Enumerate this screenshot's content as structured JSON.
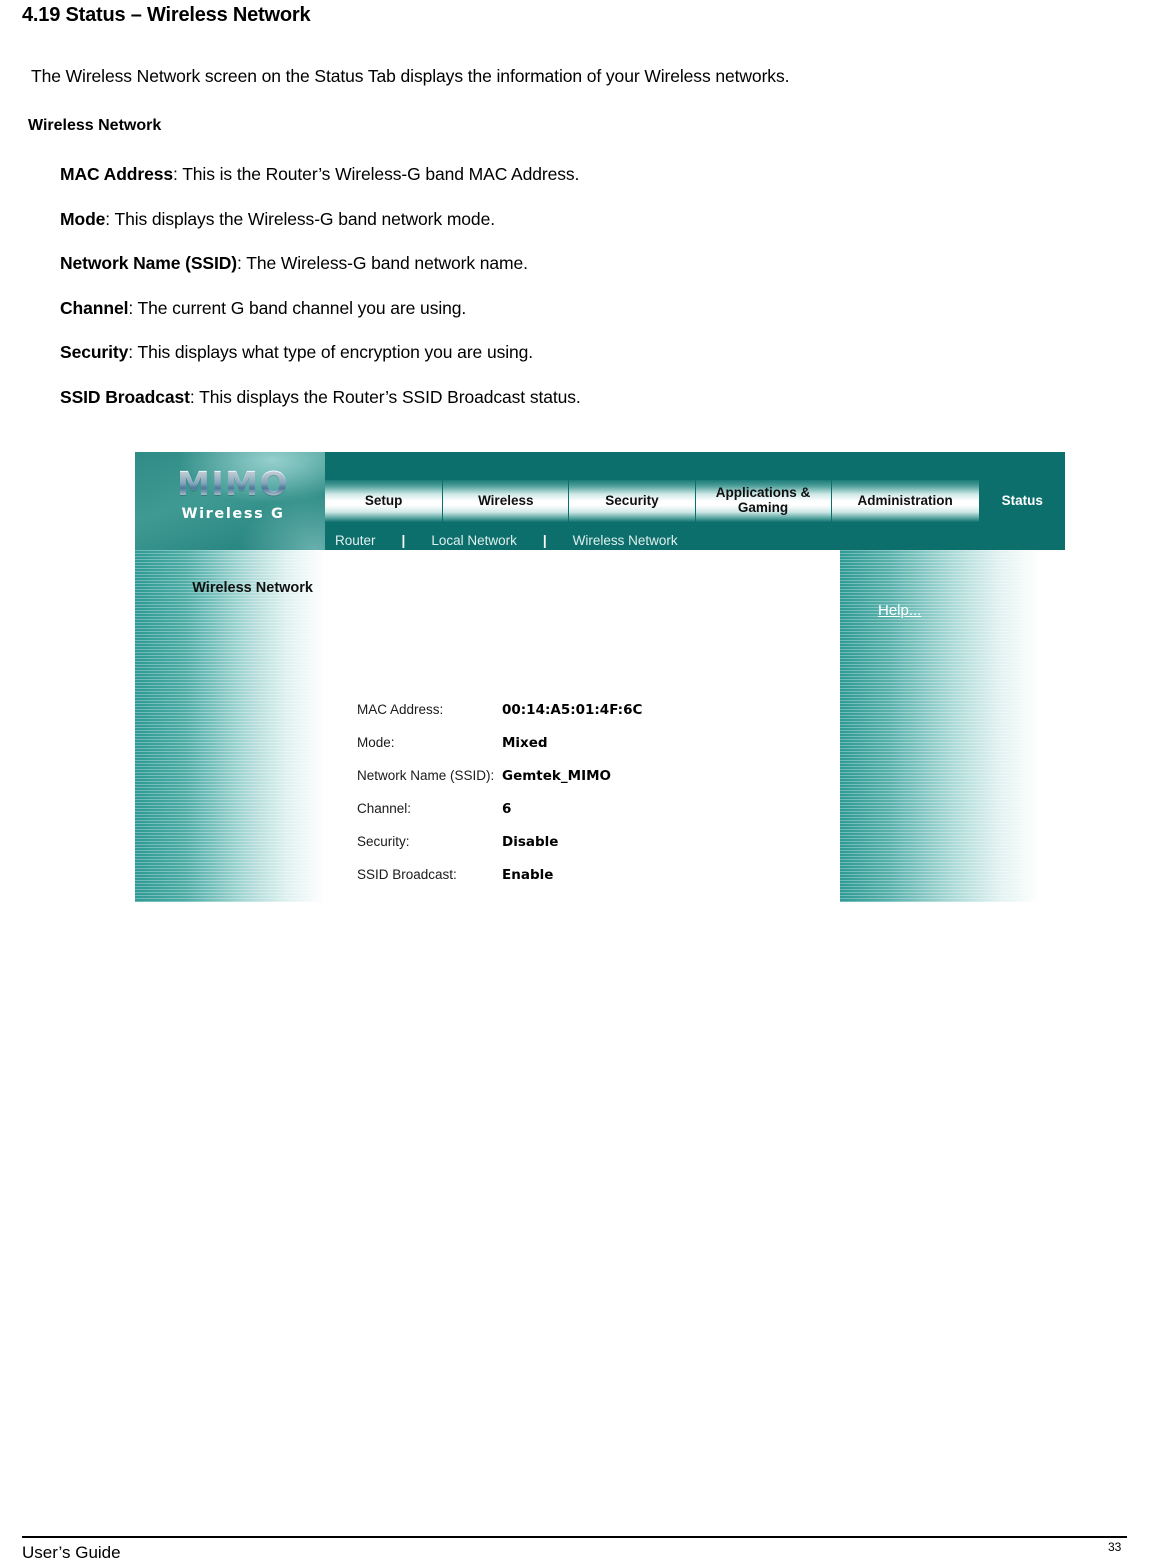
{
  "document": {
    "title": "4.19 Status – Wireless Network",
    "intro": "The Wireless Network screen on the Status Tab displays the information of your Wireless networks.",
    "subheading": "Wireless Network",
    "definitions": [
      {
        "term": "MAC Address",
        "text": ": This is the Router’s Wireless-G band MAC Address."
      },
      {
        "term": "Mode",
        "text": ": This displays the Wireless-G band network mode."
      },
      {
        "term": "Network Name (SSID)",
        "text": ": The Wireless-G band network name."
      },
      {
        "term": "Channel",
        "text": ": The current G band channel you are using."
      },
      {
        "term": "Security",
        "text": ": This displays what type of encryption you are using."
      },
      {
        "term": "SSID Broadcast",
        "text": ": This displays the Router’s SSID Broadcast status."
      }
    ]
  },
  "screenshot": {
    "logo": {
      "brand": "MIMO",
      "tagline": "Wireless G"
    },
    "tabs": [
      {
        "label": "Setup",
        "active": false
      },
      {
        "label": "Wireless",
        "active": false
      },
      {
        "label": "Security",
        "active": false
      },
      {
        "label": "Applications & Gaming",
        "active": false
      },
      {
        "label": "Administration",
        "active": false
      },
      {
        "label": "Status",
        "active": true
      }
    ],
    "tab_labels": {
      "setup": "Setup",
      "wireless": "Wireless",
      "security": "Security",
      "apps_line1": "Applications &",
      "apps_line2": "Gaming",
      "administration": "Administration",
      "status": "Status"
    },
    "subtabs": {
      "router": "Router",
      "local_network": "Local Network",
      "wireless_network": "Wireless Network",
      "separator": "|"
    },
    "section_title": "Wireless Network",
    "help_link": "Help...",
    "fields": [
      {
        "label": "MAC Address:",
        "value": "00:14:A5:01:4F:6C"
      },
      {
        "label": "Mode:",
        "value": "Mixed"
      },
      {
        "label": "Network Name (SSID):",
        "value": "Gemtek_MIMO"
      },
      {
        "label": "Channel:",
        "value": "6"
      },
      {
        "label": "Security:",
        "value": "Disable"
      },
      {
        "label": "SSID Broadcast:",
        "value": "Enable"
      }
    ],
    "colors": {
      "header_teal": "#0d6f6c",
      "panel_teal": "#2f9a95",
      "tab_text": "#101010",
      "active_tab_text": "#ffffff"
    }
  },
  "footer": {
    "left": "User’s Guide",
    "page_number": "33"
  }
}
